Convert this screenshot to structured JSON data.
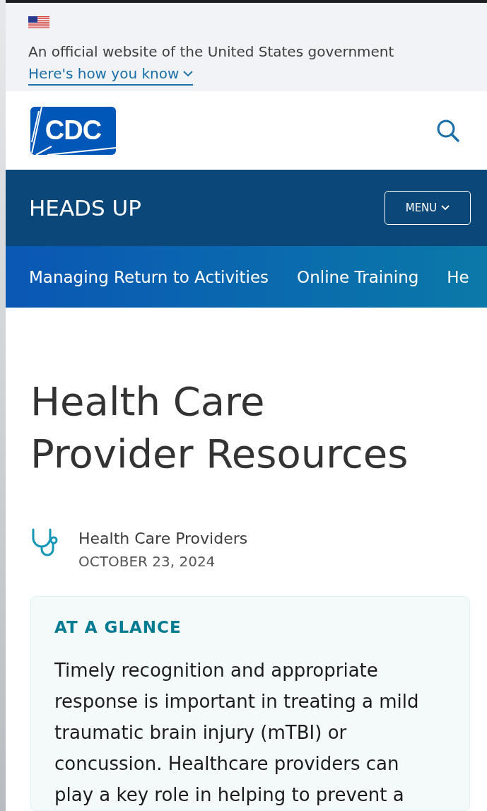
{
  "gov_banner": {
    "text": "An official website of the United States government",
    "link": "Here's how you know",
    "expanded": false
  },
  "header": {
    "logo": "CDC"
  },
  "site_bar": {
    "title": "HEADS UP",
    "menu_button": "MENU"
  },
  "nav": [
    {
      "label": "Managing Return to Activities"
    },
    {
      "label": "Online Training"
    },
    {
      "label": "He"
    }
  ],
  "page_title": "Health Care Provider Resources",
  "meta": {
    "audience": "Health Care Providers",
    "date": "OCTOBER 23, 2024"
  },
  "glance": {
    "heading": "AT A GLANCE",
    "body": "Timely recognition and appropriate response is important in treating a mild traumatic brain injury (mTBI) or concussion. Healthcare providers can play a key role in helping to prevent a"
  }
}
